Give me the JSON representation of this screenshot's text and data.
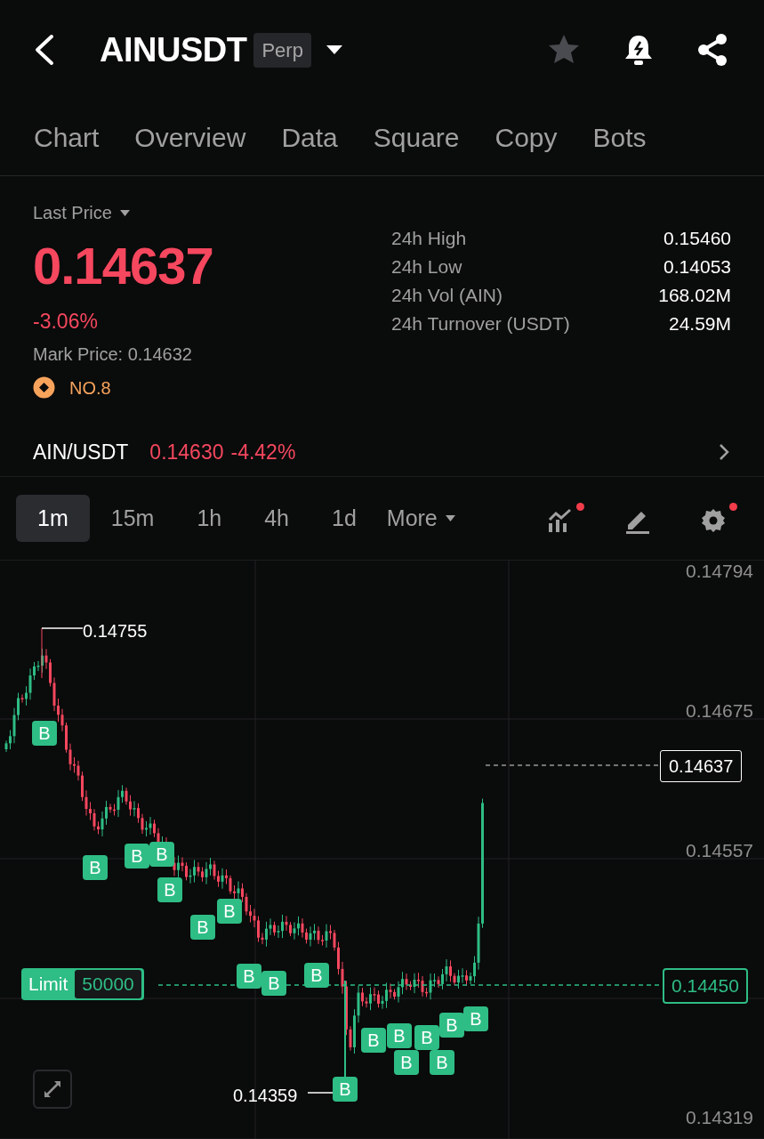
{
  "header": {
    "symbol": "AINUSDT",
    "badge": "Perp",
    "favorited": false
  },
  "tabs": [
    {
      "label": "Chart"
    },
    {
      "label": "Overview"
    },
    {
      "label": "Data"
    },
    {
      "label": "Square"
    },
    {
      "label": "Copy"
    },
    {
      "label": "Bots"
    }
  ],
  "price_info": {
    "last_price_label": "Last Price",
    "price": "0.14637",
    "change": "-3.06%",
    "mark_price": "Mark Price: 0.14632",
    "rank": "NO.8"
  },
  "stats": [
    {
      "label": "24h High",
      "value": "0.15460"
    },
    {
      "label": "24h Low",
      "value": "0.14053"
    },
    {
      "label": "24h Vol (AIN)",
      "value": "168.02M"
    },
    {
      "label": "24h Turnover (USDT)",
      "value": "24.59M"
    }
  ],
  "spot": {
    "pair": "AIN/USDT",
    "price": "0.14630",
    "change": "-4.42%"
  },
  "intervals": [
    {
      "label": "1m",
      "selected": true
    },
    {
      "label": "15m",
      "selected": false
    },
    {
      "label": "1h",
      "selected": false
    },
    {
      "label": "4h",
      "selected": false
    },
    {
      "label": "1d",
      "selected": false
    }
  ],
  "more_label": "More",
  "tools": [
    {
      "kind": "indicators",
      "notification": true
    },
    {
      "kind": "draw",
      "notification": false
    },
    {
      "kind": "settings",
      "notification": true
    }
  ],
  "chart": {
    "y_labels": [
      "0.14794",
      "0.14675",
      "0.14557",
      "0.14319"
    ],
    "high_label": "0.14755",
    "low_label": "0.14359",
    "current_price": "0.14637",
    "limit": {
      "label": "Limit",
      "amount": "50000",
      "price": "0.14450"
    },
    "markers": [
      {
        "label": "B"
      },
      {
        "label": "B"
      },
      {
        "label": "B"
      },
      {
        "label": "B"
      },
      {
        "label": "B"
      },
      {
        "label": "B"
      },
      {
        "label": "B"
      },
      {
        "label": "B"
      },
      {
        "label": "B"
      },
      {
        "label": "B"
      },
      {
        "label": "B"
      },
      {
        "label": "B"
      },
      {
        "label": "B"
      },
      {
        "label": "B"
      },
      {
        "label": "B"
      },
      {
        "label": "B"
      },
      {
        "label": "B"
      },
      {
        "label": "B"
      }
    ]
  }
}
